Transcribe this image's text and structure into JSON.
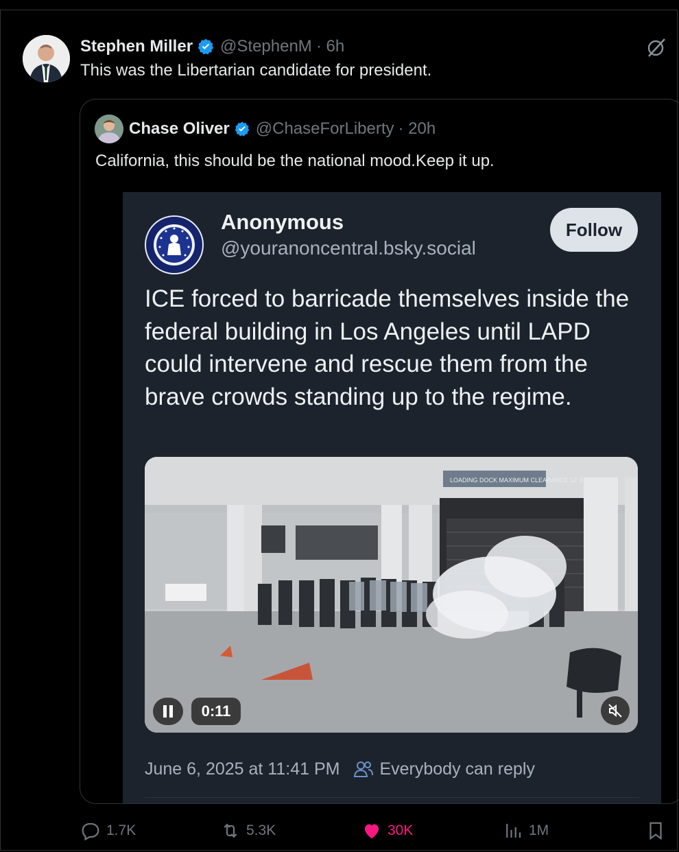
{
  "author": {
    "name": "Stephen Miller",
    "handle": "@StephenM",
    "time": "· 6h",
    "text": "This was the Libertarian candidate for president."
  },
  "quoted": {
    "name": "Chase Oliver",
    "handle": "@ChaseForLiberty",
    "time": "· 20h",
    "text": "California, this should be the national mood.Keep it up."
  },
  "embedded_post": {
    "name": "Anonymous",
    "handle": "@youranoncentral.bsky.social",
    "follow_label": "Follow",
    "text": "ICE forced to barricade themselves inside the federal building in Los Angeles until LAPD could intervene and rescue them from the brave crowds standing up to the regime.",
    "video": {
      "timestamp": "0:11",
      "sign_text": "LOADING DOCK MAXIMUM CLEARANCE 12' 6\""
    },
    "date": "June 6, 2025 at 11:41 PM",
    "reply_setting": "Everybody can reply"
  },
  "actions": {
    "replies": "1.7K",
    "reposts": "5.3K",
    "likes": "30K",
    "views": "1M"
  },
  "colors": {
    "background": "#000000",
    "verified": "#1d9bf0",
    "like_active": "#f91880",
    "muted_text": "#71767b",
    "embed_bg": "#1d232d"
  }
}
